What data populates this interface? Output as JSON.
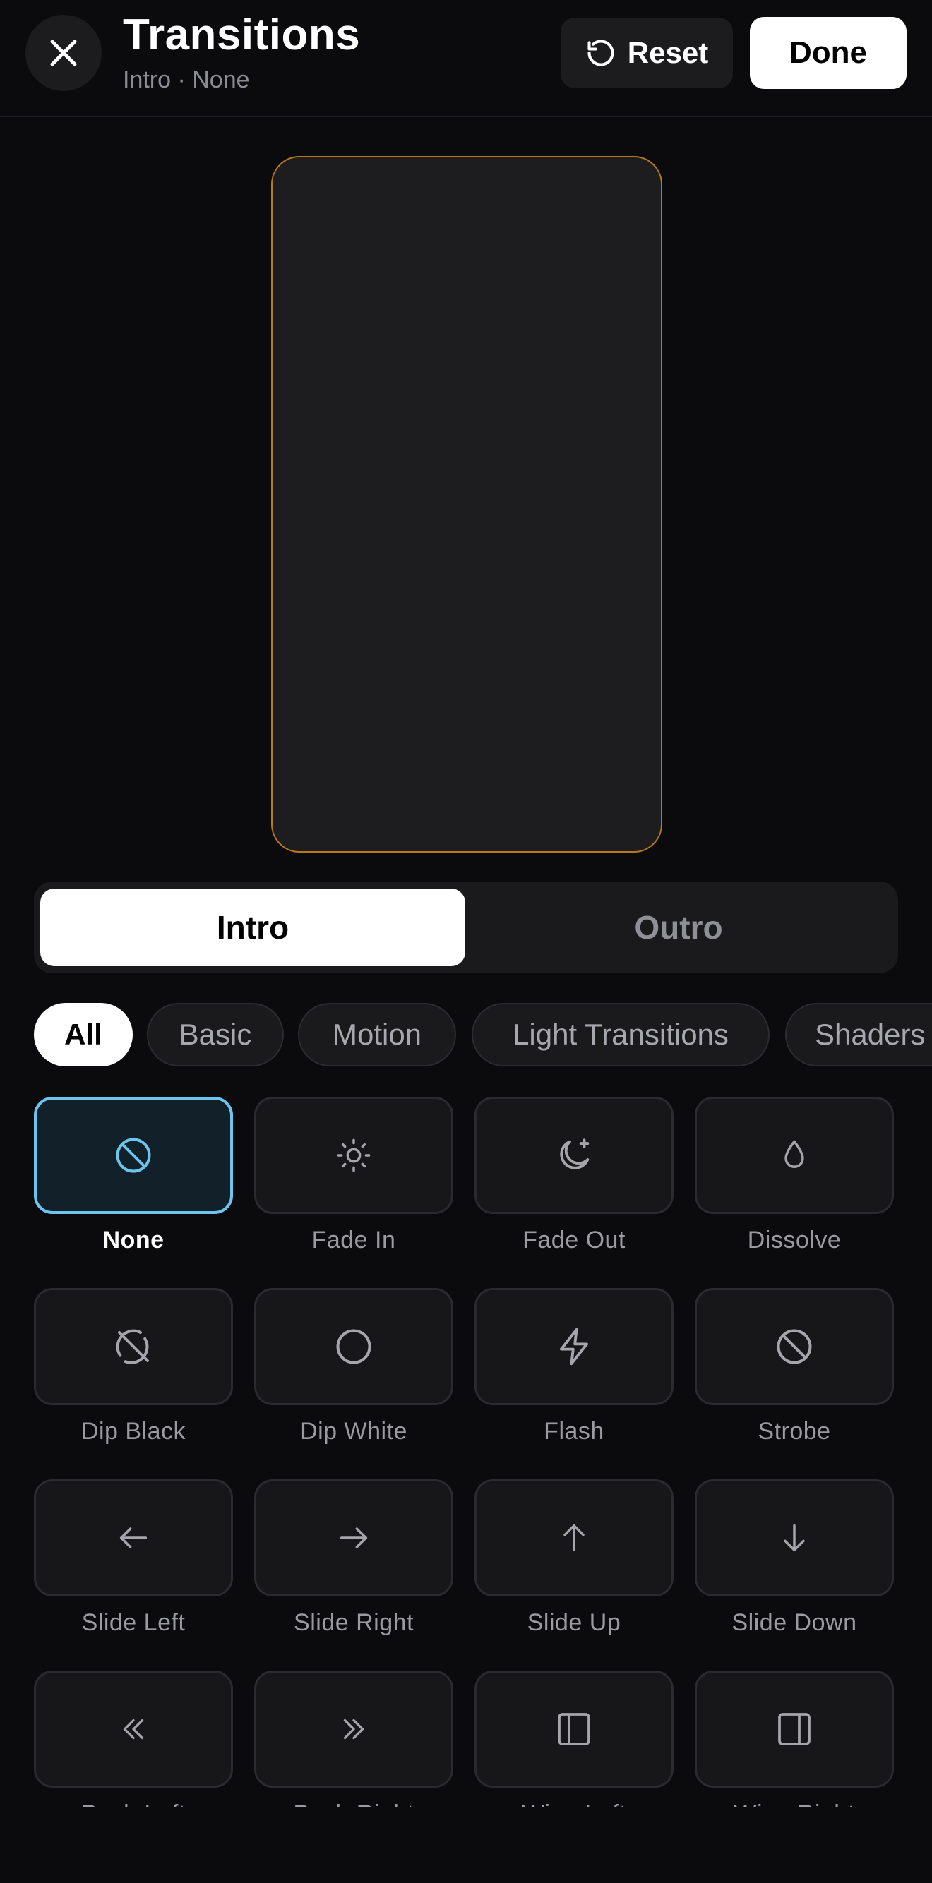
{
  "header": {
    "title": "Transitions",
    "subtitle": "Intro · None",
    "reset_label": "Reset",
    "done_label": "Done"
  },
  "segment": {
    "options": [
      "Intro",
      "Outro"
    ],
    "selected": "Intro"
  },
  "categories": [
    "All",
    "Basic",
    "Motion",
    "Light Transitions",
    "Shaders"
  ],
  "selected_category": "All",
  "transitions": [
    {
      "label": "None",
      "icon": "no-symbol-icon",
      "selected": true
    },
    {
      "label": "Fade In",
      "icon": "sun-icon"
    },
    {
      "label": "Fade Out",
      "icon": "moon-star-icon"
    },
    {
      "label": "Dissolve",
      "icon": "droplet-icon"
    },
    {
      "label": "Dip Black",
      "icon": "circle-off-icon"
    },
    {
      "label": "Dip White",
      "icon": "circle-icon"
    },
    {
      "label": "Flash",
      "icon": "lightning-icon"
    },
    {
      "label": "Strobe",
      "icon": "ban-icon"
    },
    {
      "label": "Slide Left",
      "icon": "arrow-left-icon"
    },
    {
      "label": "Slide Right",
      "icon": "arrow-right-icon"
    },
    {
      "label": "Slide Up",
      "icon": "arrow-up-icon"
    },
    {
      "label": "Slide Down",
      "icon": "arrow-down-icon"
    },
    {
      "label": "Push Left",
      "icon": "chevrons-left-icon"
    },
    {
      "label": "Push Right",
      "icon": "chevrons-right-icon"
    },
    {
      "label": "Wipe Left",
      "icon": "panel-left-icon"
    },
    {
      "label": "Wipe Right",
      "icon": "panel-right-icon"
    }
  ],
  "colors": {
    "background": "#0b0b0d",
    "preview_border": "#b9781e",
    "selected_accent": "#6cc5ef"
  }
}
